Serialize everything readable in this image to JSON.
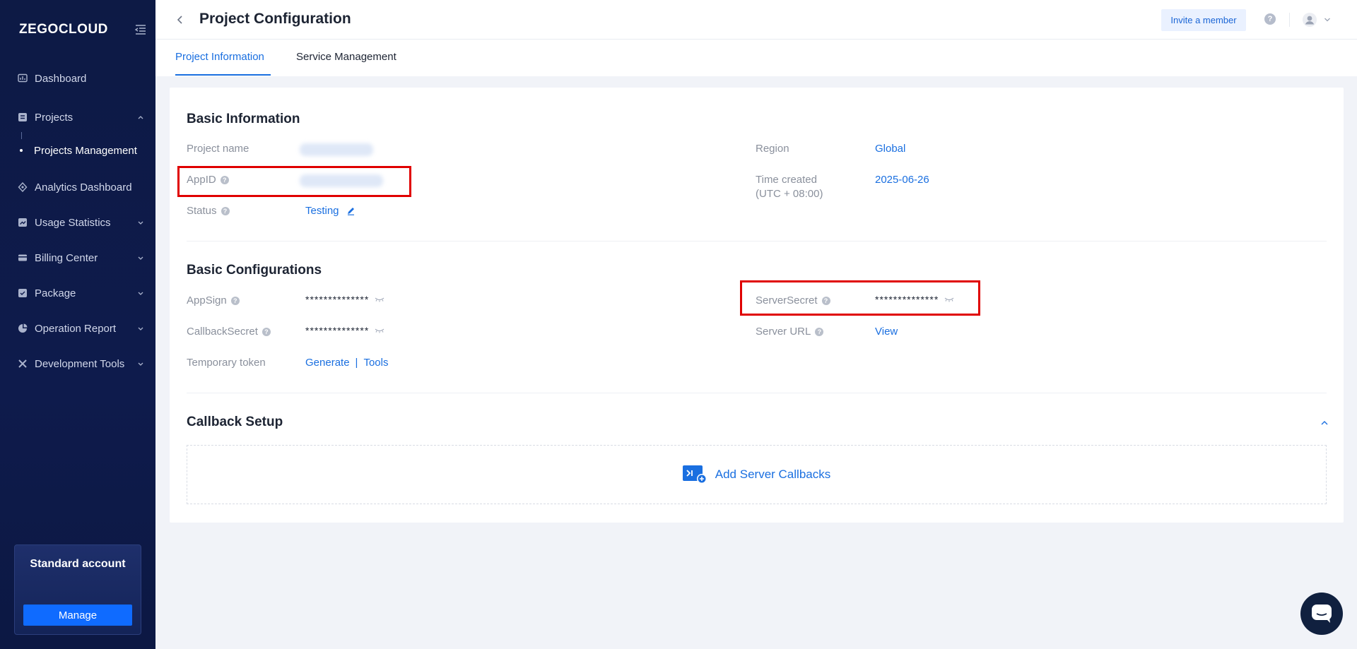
{
  "brand": {
    "logo_text": "ZEGOCLOUD"
  },
  "sidebar": {
    "items": [
      {
        "label": "Dashboard",
        "icon": "dashboard-icon"
      },
      {
        "label": "Projects",
        "icon": "projects-icon",
        "expanded": true
      },
      {
        "label": "Projects Management",
        "sub": true,
        "active": true
      },
      {
        "label": "Analytics Dashboard",
        "icon": "analytics-icon"
      },
      {
        "label": "Usage Statistics",
        "icon": "usage-icon"
      },
      {
        "label": "Billing Center",
        "icon": "billing-icon"
      },
      {
        "label": "Package",
        "icon": "package-icon"
      },
      {
        "label": "Operation Report",
        "icon": "report-icon"
      },
      {
        "label": "Development Tools",
        "icon": "tools-icon"
      }
    ],
    "account": {
      "title": "Standard account",
      "manage_label": "Manage"
    }
  },
  "header": {
    "title": "Project Configuration",
    "invite_label": "Invite a member"
  },
  "tabs": [
    {
      "label": "Project Information",
      "active": true
    },
    {
      "label": "Service Management",
      "active": false
    }
  ],
  "basic_info": {
    "title": "Basic Information",
    "project_name_label": "Project name",
    "appid_label": "AppID",
    "status_label": "Status",
    "status_value": "Testing",
    "region_label": "Region",
    "region_value": "Global",
    "time_created_label": "Time created",
    "time_created_tz": "(UTC + 08:00)",
    "time_created_value": "2025-06-26"
  },
  "basic_config": {
    "title": "Basic Configurations",
    "appsign_label": "AppSign",
    "appsign_value": "**************",
    "callbacksecret_label": "CallbackSecret",
    "callbacksecret_value": "**************",
    "temp_token_label": "Temporary token",
    "generate_label": "Generate",
    "separator": "|",
    "tools_label": "Tools",
    "serversecret_label": "ServerSecret",
    "serversecret_value": "**************",
    "serverurl_label": "Server URL",
    "serverurl_value": "View"
  },
  "callback": {
    "title": "Callback Setup",
    "add_label": "Add Server Callbacks"
  },
  "colors": {
    "sidebar_bg": "#0e1b4c",
    "accent": "#1a6fe0",
    "highlight_box": "#e00000"
  }
}
